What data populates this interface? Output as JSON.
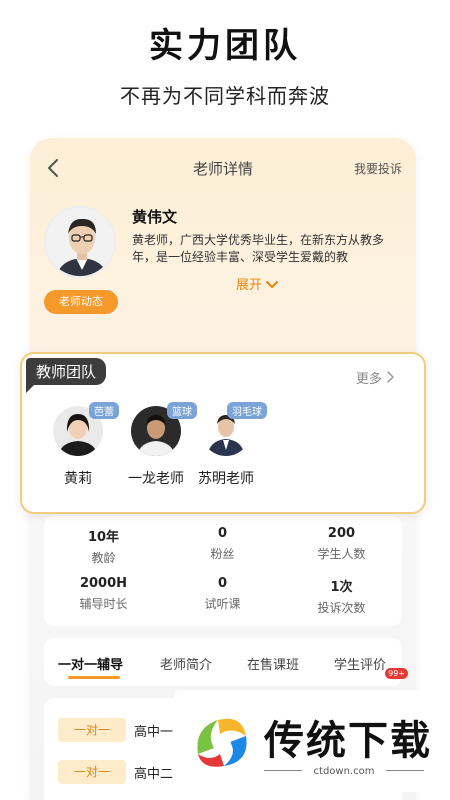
{
  "promo": {
    "title": "实力团队",
    "subtitle": "不再为不同学科而奔波"
  },
  "nav": {
    "back_icon": "chevron-left-icon",
    "title": "老师详情",
    "complain_label": "我要投诉"
  },
  "teacher": {
    "name": "黄伟文",
    "description": "黄老师，广西大学优秀毕业生，在新东方从教多年，是一位经验丰富、深受学生爱戴的教",
    "dynamic_button": "老师动态",
    "expand_label": "展开"
  },
  "team": {
    "tag": "教师团队",
    "more_label": "更多",
    "members": [
      {
        "name": "黄莉",
        "subject": "芭蕾"
      },
      {
        "name": "一龙老师",
        "subject": "篮球"
      },
      {
        "name": "苏明老师",
        "subject": "羽毛球"
      }
    ]
  },
  "stats": [
    {
      "value": "10年",
      "label": "教龄"
    },
    {
      "value": "0",
      "label": "粉丝"
    },
    {
      "value": "200",
      "label": "学生人数"
    },
    {
      "value": "2000H",
      "label": "辅导时长"
    },
    {
      "value": "0",
      "label": "试听课"
    },
    {
      "value": "1次",
      "label": "投诉次数"
    }
  ],
  "tabs": [
    {
      "label": "一对一辅导",
      "active": true
    },
    {
      "label": "老师简介",
      "active": false
    },
    {
      "label": "在售课班",
      "active": false
    },
    {
      "label": "学生评价",
      "active": false
    }
  ],
  "tab_badge": "99+",
  "courses": [
    {
      "tag": "一对一",
      "title": "高中一"
    },
    {
      "tag": "一对一",
      "title": "高中二"
    }
  ],
  "watermark": {
    "brand": "传统下载",
    "url": "ctdown.com"
  },
  "colors": {
    "accent": "#f59a2a",
    "team_border": "#f3cd7b",
    "tag_dark": "#3d3d3d",
    "subject_badge": "#7aa3d8",
    "pill_bg": "#fdebc9"
  }
}
